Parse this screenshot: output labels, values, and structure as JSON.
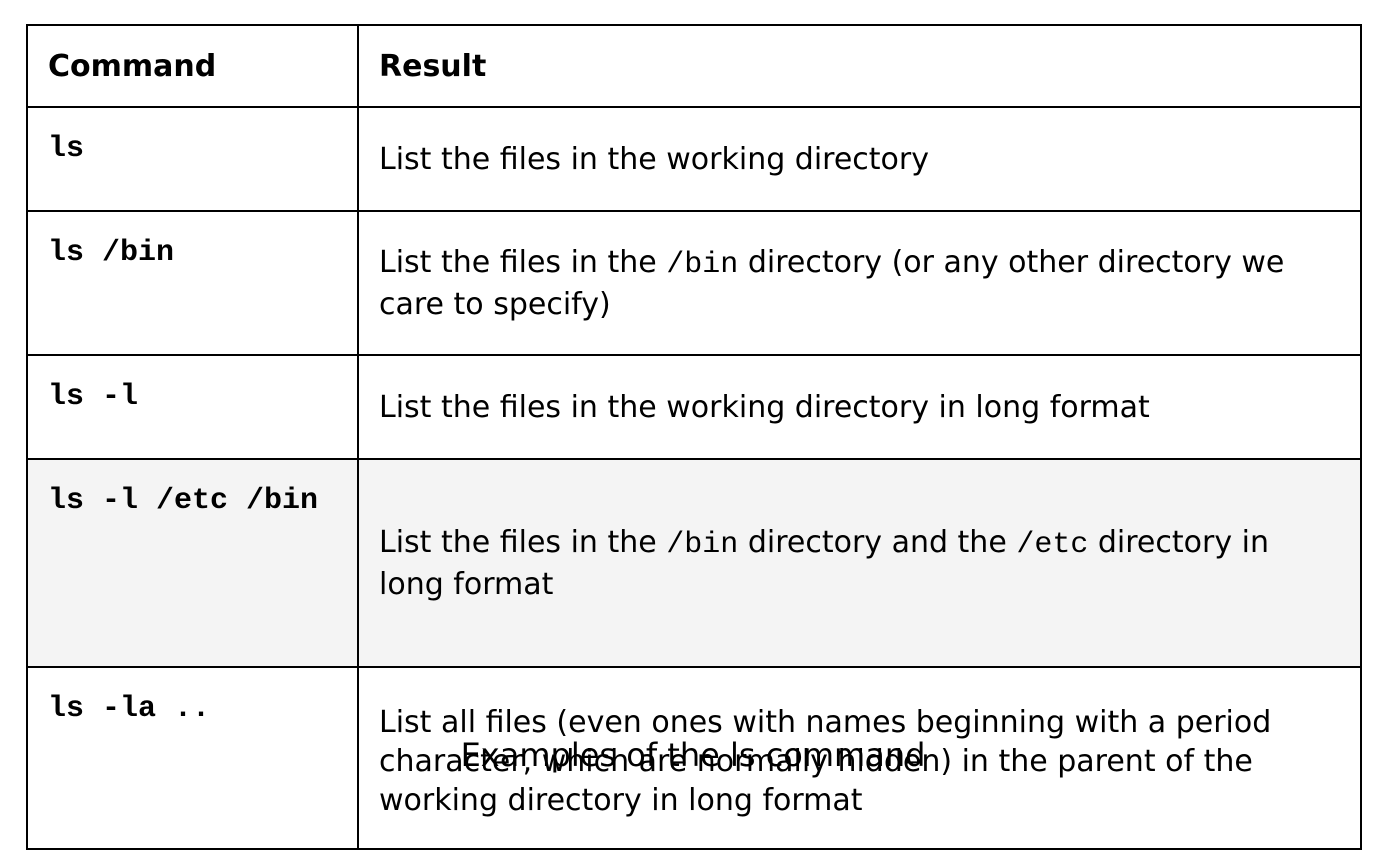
{
  "table": {
    "headers": {
      "command": "Command",
      "result": "Result"
    },
    "rows": [
      {
        "command": "ls",
        "result": "List the files in the working directory"
      },
      {
        "command": "ls /bin",
        "result_parts": [
          "List the files in the ",
          "/bin",
          " directory (or any other directory we care to specify)"
        ]
      },
      {
        "command": "ls -l",
        "result": "List the files in the working directory in long format"
      },
      {
        "command": "ls -l /etc /bin",
        "result_parts": [
          "List the files in the ",
          "/bin",
          " directory and the ",
          "/etc",
          " directory in long format"
        ]
      },
      {
        "command": "ls -la ..",
        "result": "List all files (even ones with names beginning with a period character, which are normally hidden) in the parent of the working directory in long format"
      }
    ]
  },
  "caption": "Examples of the ls command",
  "colors": {
    "border": "#000000",
    "highlight_row_bg": "#f4f4f4",
    "background": "#ffffff"
  }
}
